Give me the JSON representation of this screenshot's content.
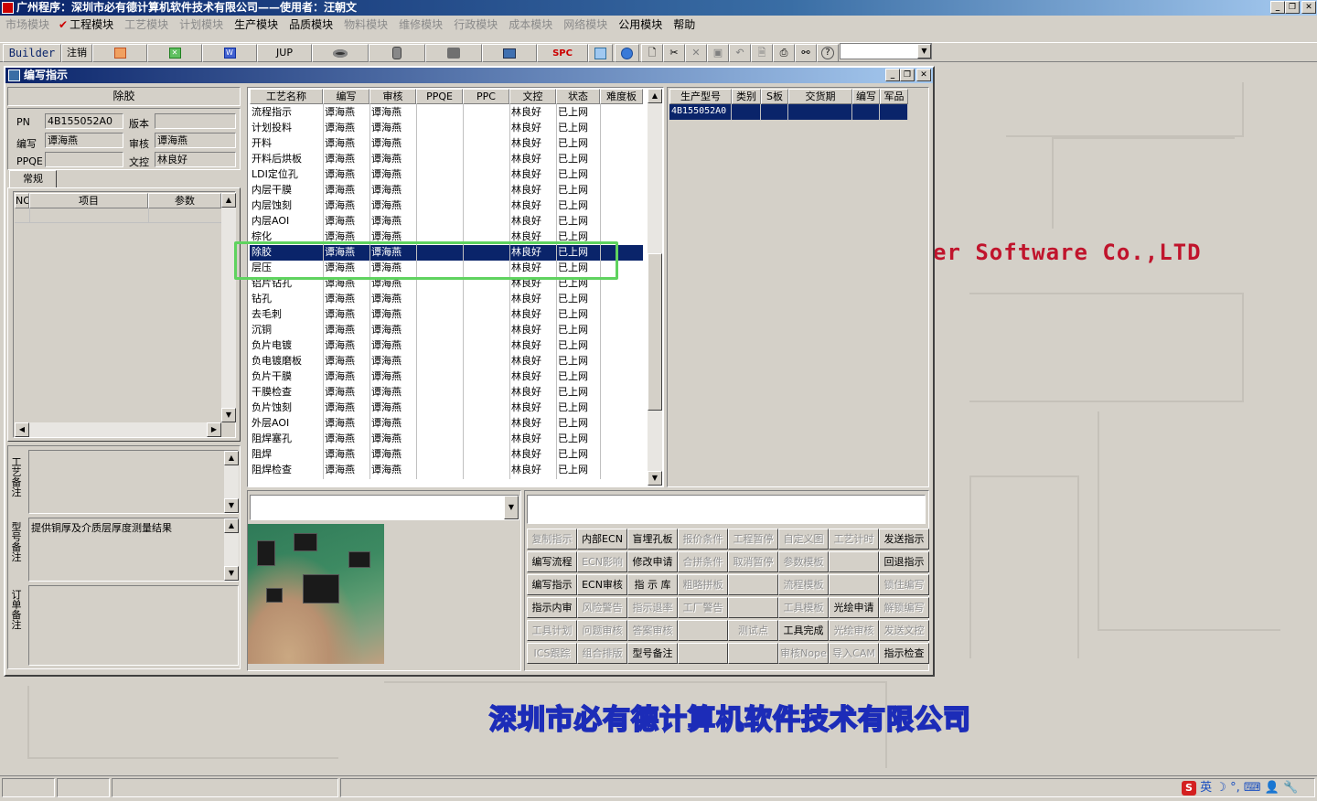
{
  "app": {
    "title": "广州程序：深圳市必有德计算机软件技术有限公司——使用者：汪朝文",
    "controls": {
      "minimize": "_",
      "restore": "❐",
      "close": "✕"
    }
  },
  "menu": {
    "items": [
      {
        "label": "市场模块",
        "enabled": false
      },
      {
        "label": "工程模块",
        "enabled": true,
        "checked": true
      },
      {
        "label": "工艺模块",
        "enabled": false
      },
      {
        "label": "计划模块",
        "enabled": false
      },
      {
        "label": "生产模块",
        "enabled": true
      },
      {
        "label": "品质模块",
        "enabled": true
      },
      {
        "label": "物料模块",
        "enabled": false
      },
      {
        "label": "维修模块",
        "enabled": false
      },
      {
        "label": "行政模块",
        "enabled": false
      },
      {
        "label": "成本模块",
        "enabled": false
      },
      {
        "label": "网络模块",
        "enabled": false
      },
      {
        "label": "公用模块",
        "enabled": true
      },
      {
        "label": "帮助",
        "enabled": true
      }
    ]
  },
  "toolbar": {
    "builder": "Builder",
    "logout": "注销",
    "jup": "JUP",
    "spc": "SPC",
    "icons": [
      "ppt-icon",
      "excel-icon",
      "word-icon",
      "eye-icon",
      "database-icon",
      "tools-icon",
      "computer-icon",
      "spreadsheet-icon",
      "ie-icon",
      "new-doc-icon",
      "cut-icon",
      "delete-icon",
      "save-icon",
      "undo-icon",
      "preview-icon",
      "print-icon",
      "binoculars-icon",
      "help-icon"
    ],
    "combo_value": ""
  },
  "background": {
    "company_en": "er Software Co.,LTD",
    "company_cn": "深圳市必有德计算机软件技术有限公司"
  },
  "window": {
    "title": "编写指示",
    "controls": {
      "minimize": "_",
      "restore": "❐",
      "close": "✕"
    }
  },
  "left": {
    "section_title": "除胶",
    "pn_label": "PN",
    "pn_value": "4B155052A0",
    "version_label": "版本",
    "version_value": "",
    "writer_label": "编写",
    "writer_value": "谭海燕",
    "reviewer_label": "审核",
    "reviewer_value": "谭海燕",
    "ppqe_label": "PPQE",
    "ppqe_value": "",
    "docctrl_label": "文控",
    "docctrl_value": "林良好",
    "tab_label": "常规",
    "params_headers": {
      "no": "NO",
      "item": "项目",
      "param": "参数"
    },
    "remark_process_label": "工艺备注",
    "remark_process_value": "",
    "remark_model_label": "型号备注",
    "remark_model_value": "提供铜厚及介质层厚度测量结果",
    "remark_order_label": "订单备注",
    "remark_order_value": ""
  },
  "process_table": {
    "headers": [
      "工艺名称",
      "编写",
      "审核",
      "PPQE",
      "PPC",
      "文控",
      "状态",
      "难度板"
    ],
    "selected_index": 9,
    "rows": [
      [
        "流程指示",
        "谭海燕",
        "谭海燕",
        "",
        "",
        "林良好",
        "已上网",
        ""
      ],
      [
        "计划投料",
        "谭海燕",
        "谭海燕",
        "",
        "",
        "林良好",
        "已上网",
        ""
      ],
      [
        "开料",
        "谭海燕",
        "谭海燕",
        "",
        "",
        "林良好",
        "已上网",
        ""
      ],
      [
        "开料后烘板",
        "谭海燕",
        "谭海燕",
        "",
        "",
        "林良好",
        "已上网",
        ""
      ],
      [
        "LDI定位孔",
        "谭海燕",
        "谭海燕",
        "",
        "",
        "林良好",
        "已上网",
        ""
      ],
      [
        "内层干膜",
        "谭海燕",
        "谭海燕",
        "",
        "",
        "林良好",
        "已上网",
        ""
      ],
      [
        "内层蚀刻",
        "谭海燕",
        "谭海燕",
        "",
        "",
        "林良好",
        "已上网",
        ""
      ],
      [
        "内层AOI",
        "谭海燕",
        "谭海燕",
        "",
        "",
        "林良好",
        "已上网",
        ""
      ],
      [
        "棕化",
        "谭海燕",
        "谭海燕",
        "",
        "",
        "林良好",
        "已上网",
        ""
      ],
      [
        "除胶",
        "谭海燕",
        "谭海燕",
        "",
        "",
        "林良好",
        "已上网",
        ""
      ],
      [
        "层压",
        "谭海燕",
        "谭海燕",
        "",
        "",
        "林良好",
        "已上网",
        ""
      ],
      [
        "铝片钻孔",
        "谭海燕",
        "谭海燕",
        "",
        "",
        "林良好",
        "已上网",
        ""
      ],
      [
        "钻孔",
        "谭海燕",
        "谭海燕",
        "",
        "",
        "林良好",
        "已上网",
        ""
      ],
      [
        "去毛刺",
        "谭海燕",
        "谭海燕",
        "",
        "",
        "林良好",
        "已上网",
        ""
      ],
      [
        "沉铜",
        "谭海燕",
        "谭海燕",
        "",
        "",
        "林良好",
        "已上网",
        ""
      ],
      [
        "负片电镀",
        "谭海燕",
        "谭海燕",
        "",
        "",
        "林良好",
        "已上网",
        ""
      ],
      [
        "负电镀磨板",
        "谭海燕",
        "谭海燕",
        "",
        "",
        "林良好",
        "已上网",
        ""
      ],
      [
        "负片干膜",
        "谭海燕",
        "谭海燕",
        "",
        "",
        "林良好",
        "已上网",
        ""
      ],
      [
        "干膜检查",
        "谭海燕",
        "谭海燕",
        "",
        "",
        "林良好",
        "已上网",
        ""
      ],
      [
        "负片蚀刻",
        "谭海燕",
        "谭海燕",
        "",
        "",
        "林良好",
        "已上网",
        ""
      ],
      [
        "外层AOI",
        "谭海燕",
        "谭海燕",
        "",
        "",
        "林良好",
        "已上网",
        ""
      ],
      [
        "阻焊塞孔",
        "谭海燕",
        "谭海燕",
        "",
        "",
        "林良好",
        "已上网",
        ""
      ],
      [
        "阻焊",
        "谭海燕",
        "谭海燕",
        "",
        "",
        "林良好",
        "已上网",
        ""
      ],
      [
        "阻焊检查",
        "谭海燕",
        "谭海燕",
        "",
        "",
        "林良好",
        "已上网",
        ""
      ]
    ]
  },
  "model_table": {
    "headers": [
      "生产型号",
      "类别",
      "S板",
      "交货期",
      "编写",
      "军品"
    ],
    "rows": [
      [
        "4B155052A0",
        "",
        "",
        "",
        "",
        ""
      ]
    ]
  },
  "bottom": {
    "combo_value": "",
    "text_value": ""
  },
  "actions": [
    [
      {
        "l": "复制指示",
        "e": false
      },
      {
        "l": "内部ECN",
        "e": true
      },
      {
        "l": "盲埋孔板",
        "e": true
      },
      {
        "l": "报价条件",
        "e": false
      },
      {
        "l": "工程暂停",
        "e": false
      },
      {
        "l": "自定义图",
        "e": false
      },
      {
        "l": "工艺计时",
        "e": false
      },
      {
        "l": "发送指示",
        "e": true
      }
    ],
    [
      {
        "l": "编写流程",
        "e": true
      },
      {
        "l": "ECN影响",
        "e": false
      },
      {
        "l": "修改申请",
        "e": true
      },
      {
        "l": "合拼条件",
        "e": false
      },
      {
        "l": "取消暂停",
        "e": false
      },
      {
        "l": "参数模板",
        "e": false
      },
      {
        "l": "",
        "e": false
      },
      {
        "l": "回退指示",
        "e": true
      }
    ],
    [
      {
        "l": "编写指示",
        "e": true
      },
      {
        "l": "ECN审核",
        "e": true
      },
      {
        "l": "指 示 库",
        "e": true
      },
      {
        "l": "粗略拼板",
        "e": false
      },
      {
        "l": "",
        "e": false
      },
      {
        "l": "流程模板",
        "e": false
      },
      {
        "l": "",
        "e": false
      },
      {
        "l": "锁住编写",
        "e": false
      }
    ],
    [
      {
        "l": "指示内审",
        "e": true
      },
      {
        "l": "风险警告",
        "e": false
      },
      {
        "l": "指示退率",
        "e": false
      },
      {
        "l": "工厂警告",
        "e": false
      },
      {
        "l": "",
        "e": false
      },
      {
        "l": "工具模板",
        "e": false
      },
      {
        "l": "光绘申请",
        "e": true
      },
      {
        "l": "解锁编写",
        "e": false
      }
    ],
    [
      {
        "l": "工具计划",
        "e": false
      },
      {
        "l": "问题审核",
        "e": false
      },
      {
        "l": "答案审核",
        "e": false
      },
      {
        "l": "",
        "e": false
      },
      {
        "l": "测试点",
        "e": false
      },
      {
        "l": "工具完成",
        "e": true
      },
      {
        "l": "光绘审核",
        "e": false
      },
      {
        "l": "发送文控",
        "e": false
      }
    ],
    [
      {
        "l": "ICS跟踪",
        "e": false
      },
      {
        "l": "组合排版",
        "e": false
      },
      {
        "l": "型号备注",
        "e": true
      },
      {
        "l": "",
        "e": false
      },
      {
        "l": "",
        "e": false
      },
      {
        "l": "审核Nope",
        "e": false
      },
      {
        "l": "导入CAM",
        "e": false
      },
      {
        "l": "指示检查",
        "e": true
      }
    ]
  ],
  "statusbar": {
    "panels": [
      "",
      "",
      "",
      ""
    ],
    "tray": {
      "ime_logo": "S",
      "ime_lang": "英",
      "moon": "☽",
      "punct": "°,",
      "keyboard": "⌨",
      "user": "👤",
      "tools": "🔧"
    }
  }
}
